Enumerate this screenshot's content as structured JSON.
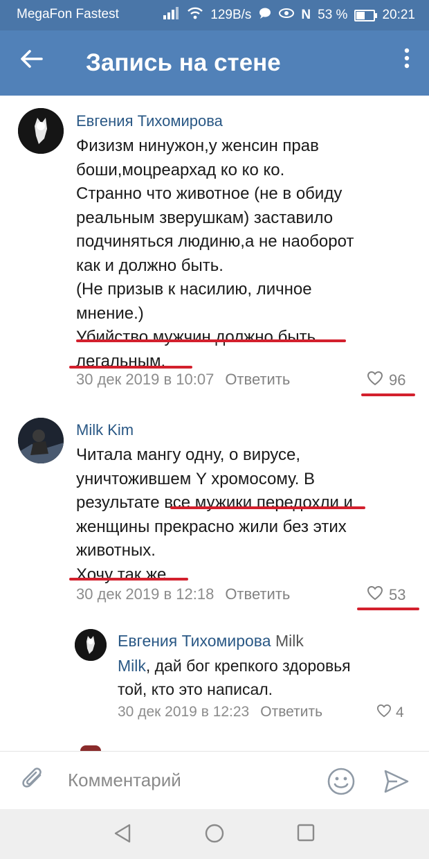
{
  "status_bar": {
    "carrier": "MegaFon Fastest",
    "speed": "129B/s",
    "battery_percent": "53 %",
    "time": "20:21"
  },
  "app_bar": {
    "title": "Запись на стене"
  },
  "comments": [
    {
      "author": "Евгения Тихомирова",
      "lines": [
        "Физизм нинужон,у женсин прав",
        "боши,моцреархад ко ко ко.",
        "Странно что животное (не в обиду",
        "реальным зверушкам) заставило",
        "подчиняться людиню,а не наоборот",
        "как и должно быть.",
        "(Не призыв к насилию, личное",
        "мнение.)",
        "Убийство мужчин должно быть",
        "легальным."
      ],
      "date": "30 дек 2019 в 10:07",
      "reply_label": "Ответить",
      "likes": "96"
    },
    {
      "author": "Milk Kim",
      "lines": [
        "Читала мангу одну, о вирусе,",
        "уничтожившем Y хромосому. В",
        "результате все мужики передохли и",
        "женщины прекрасно жили без этих",
        "животных.",
        "Хочу так же."
      ],
      "date": "30 дек 2019 в 12:18",
      "reply_label": "Ответить",
      "likes": "53"
    },
    {
      "author": "Евгения Тихомирова",
      "reply_to": "Milk",
      "mention": "Milk",
      "lines_after_mention": ", дай бог крепкого здоровья",
      "lines": [
        "той, кто это написал."
      ],
      "date": "30 дек 2019 в 12:23",
      "reply_label": "Ответить",
      "likes": "4"
    }
  ],
  "input": {
    "placeholder": "Комментарий"
  },
  "icons": [
    "back-arrow-icon",
    "more-vertical-icon",
    "heart-icon",
    "paperclip-icon",
    "emoji-icon",
    "send-icon",
    "nav-back-icon",
    "nav-home-icon",
    "nav-recents-icon"
  ]
}
